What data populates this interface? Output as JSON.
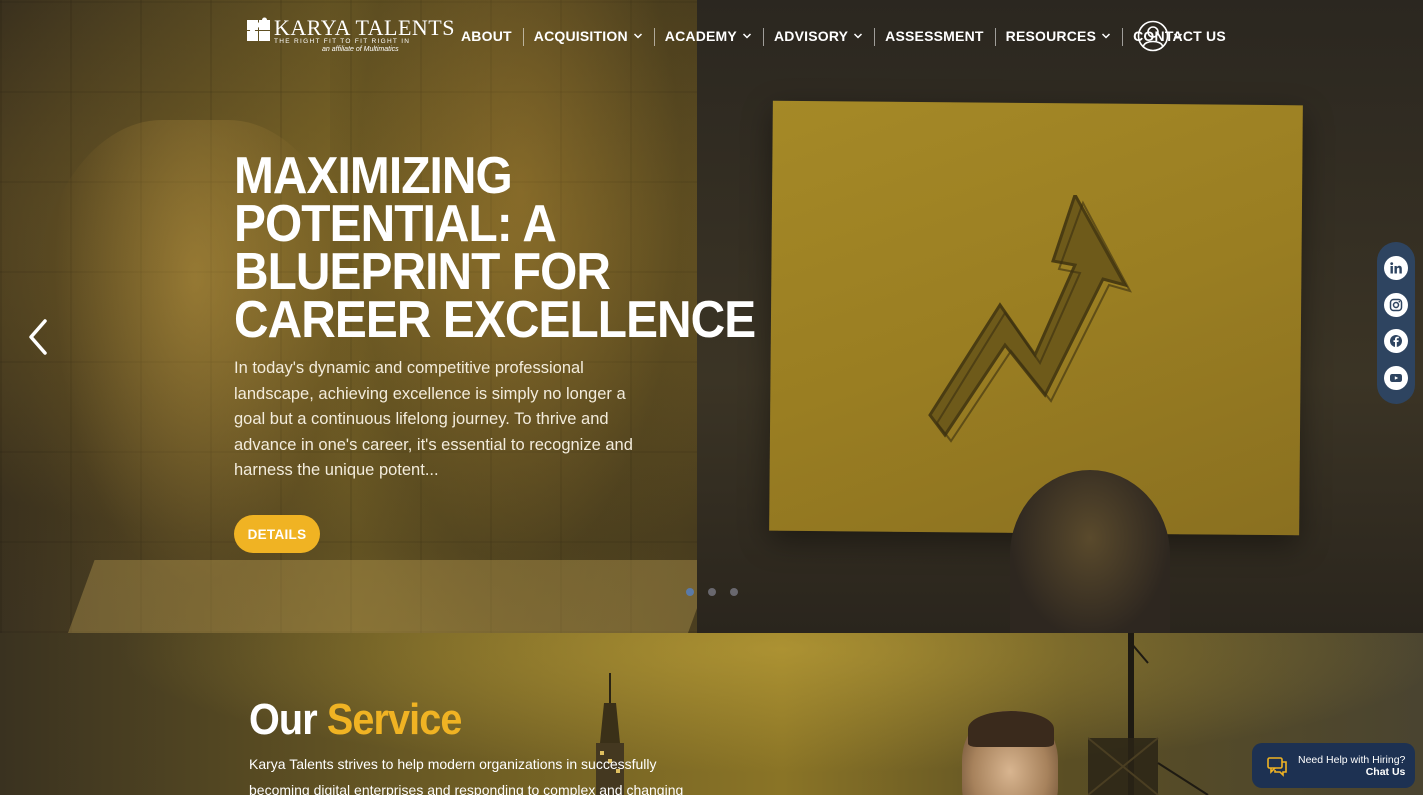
{
  "nav": {
    "logo": {
      "title": "KARYA TALENTS",
      "tagline": "THE RIGHT FIT TO FIT RIGHT IN",
      "affiliate": "an affiliate of Multimatics"
    },
    "items": [
      {
        "label": "ABOUT",
        "dropdown": false
      },
      {
        "label": "ACQUISITION",
        "dropdown": true
      },
      {
        "label": "ACADEMY",
        "dropdown": true
      },
      {
        "label": "ADVISORY",
        "dropdown": true
      },
      {
        "label": "ASSESSMENT",
        "dropdown": false
      },
      {
        "label": "RESOURCES",
        "dropdown": true
      },
      {
        "label": "CONTACT US",
        "dropdown": false
      }
    ],
    "user_icon": "user-icon"
  },
  "hero": {
    "title": "MAXIMIZING POTENTIAL: A BLUEPRINT FOR CAREER EXCELLENCE",
    "description": "In today's dynamic and competitive professional landscape, achieving excellence is simply no longer a goal but a continuous lifelong journey. To thrive and advance in one's career, it's essential to recognize and harness the unique potent...",
    "button_label": "DETAILS",
    "slides_count": 3,
    "active_slide": 1
  },
  "social": [
    "linkedin-icon",
    "instagram-icon",
    "facebook-icon",
    "youtube-icon"
  ],
  "services": {
    "title_plain": "Our",
    "title_accent": "Service",
    "description": "Karya Talents strives to help modern organizations in successfully becoming digital enterprises and responding to complex and changing"
  },
  "chat": {
    "line1": "Need Help with Hiring?",
    "line2": "Chat Us"
  },
  "colors": {
    "accent": "#f0b323",
    "social_bar": "#2e4460",
    "chat_bg": "#1d3152"
  }
}
